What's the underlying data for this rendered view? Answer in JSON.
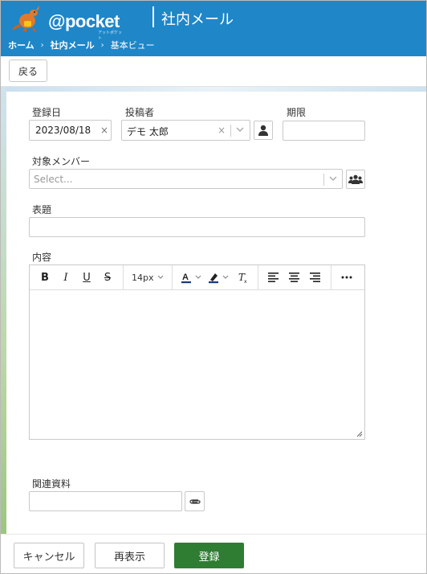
{
  "header": {
    "logo_text": "@pocket",
    "logo_sub": "アットポケット",
    "app_title": "社内メール",
    "breadcrumb": [
      "ホーム",
      "社内メール",
      "基本ビュー"
    ]
  },
  "toolbar": {
    "back_label": "戻る"
  },
  "form": {
    "registration_date": {
      "label": "登録日",
      "value": "2023/08/18"
    },
    "poster": {
      "label": "投稿者",
      "value": "デモ 太郎"
    },
    "deadline": {
      "label": "期限",
      "value": ""
    },
    "members": {
      "label": "対象メンバー",
      "placeholder": "Select..."
    },
    "subject": {
      "label": "表題",
      "value": ""
    },
    "content": {
      "label": "内容",
      "font_size": "14px"
    },
    "attachments": {
      "label": "関連資料",
      "value": ""
    }
  },
  "footer": {
    "cancel_label": "キャンセル",
    "reload_label": "再表示",
    "submit_label": "登録"
  },
  "colors": {
    "header_bg": "#1f86c8",
    "primary_button": "#2f7d33"
  }
}
